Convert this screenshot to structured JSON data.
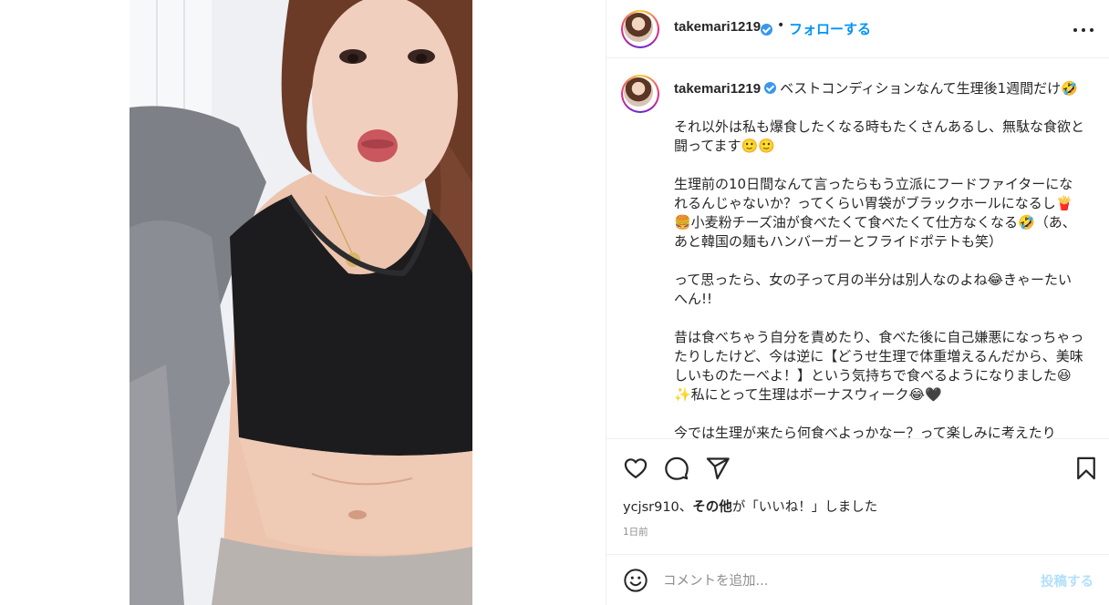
{
  "post": {
    "username": "takemari1219",
    "dot": "•",
    "follow_label": "フォローする"
  },
  "caption": {
    "username": "takemari1219",
    "paragraphs": [
      "ベストコンディションなんて生理後1週間だけ🤣",
      "それ以外は私も爆食したくなる時もたくさんあるし、無駄な食欲と闘ってます🙂🙂",
      "生理前の10日間なんて言ったらもう立派にフードファイターになれるんじゃないか？ってくらい胃袋がブラックホールになるし🍟🍔小麦粉チーズ油が食べたくて食べたくて仕方なくなる🤣（あ、あと韓国の麺もハンバーガーとフライドポテトも笑）",
      "って思ったら、女の子って月の半分は別人なのよね😂きゃーたいへん!!",
      "昔は食べちゃう自分を責めたり、食べた後に自己嫌悪になっちゃったりしたけど、今は逆に【どうせ生理で体重増えるんだから、美味しいものたーべよ！】という気持ちで食べるようになりました😆✨私にとって生理はボーナスウィーク😂🖤",
      "今では生理が来たら何食べよっかなー？って楽しみに考えたり"
    ]
  },
  "likes": {
    "user": "ycjsr910",
    "sep": "、",
    "others": "その他",
    "suffix": "が「いいね！」しました"
  },
  "timestamp": "1日前",
  "comment": {
    "placeholder": "コメントを追加...",
    "post_label": "投稿する"
  },
  "colors": {
    "accent": "#0095f6",
    "verified": "#3897f0",
    "post_disabled": "#b2dffc",
    "text": "#262626",
    "muted": "#8e8e8e"
  },
  "icons": [
    "heart-icon",
    "comment-icon",
    "share-icon",
    "bookmark-icon",
    "emoji-icon",
    "more-icon",
    "verified-icon"
  ]
}
